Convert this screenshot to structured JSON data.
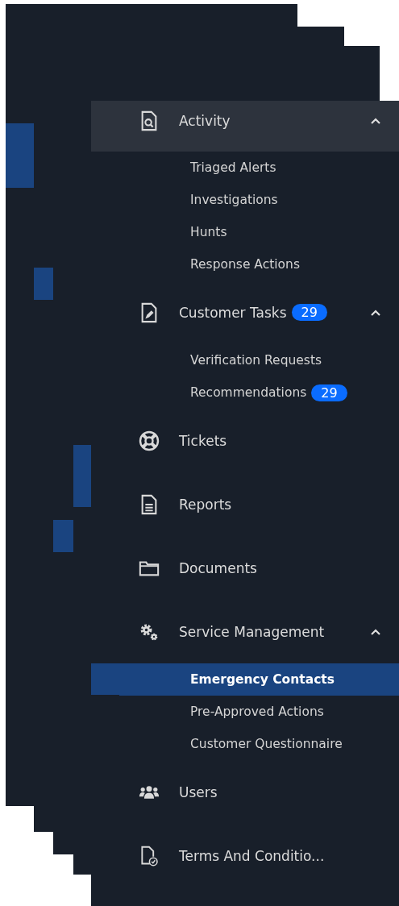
{
  "nav": [
    {
      "label": "Activity",
      "expanded": true,
      "highlighted": true,
      "children": [
        {
          "label": "Triaged Alerts",
          "selected": false
        },
        {
          "label": "Investigations",
          "selected": false
        },
        {
          "label": "Hunts",
          "selected": false
        },
        {
          "label": "Response Actions",
          "selected": false
        }
      ]
    },
    {
      "label": "Customer Tasks",
      "badge": "29",
      "expanded": true,
      "highlighted": false,
      "children": [
        {
          "label": "Verification Requests",
          "selected": false
        },
        {
          "label": "Recommendations",
          "badge": "29",
          "selected": false
        }
      ]
    },
    {
      "label": "Tickets",
      "highlighted": false
    },
    {
      "label": "Reports",
      "highlighted": false
    },
    {
      "label": "Documents",
      "highlighted": false
    },
    {
      "label": "Service Management",
      "expanded": true,
      "highlighted": false,
      "children": [
        {
          "label": "Emergency Contacts",
          "selected": true
        },
        {
          "label": "Pre-Approved Actions",
          "selected": false
        },
        {
          "label": "Customer Questionnaire",
          "selected": false
        }
      ]
    },
    {
      "label": "Users",
      "highlighted": false
    },
    {
      "label": "Terms And Conditio...",
      "highlighted": false
    }
  ]
}
